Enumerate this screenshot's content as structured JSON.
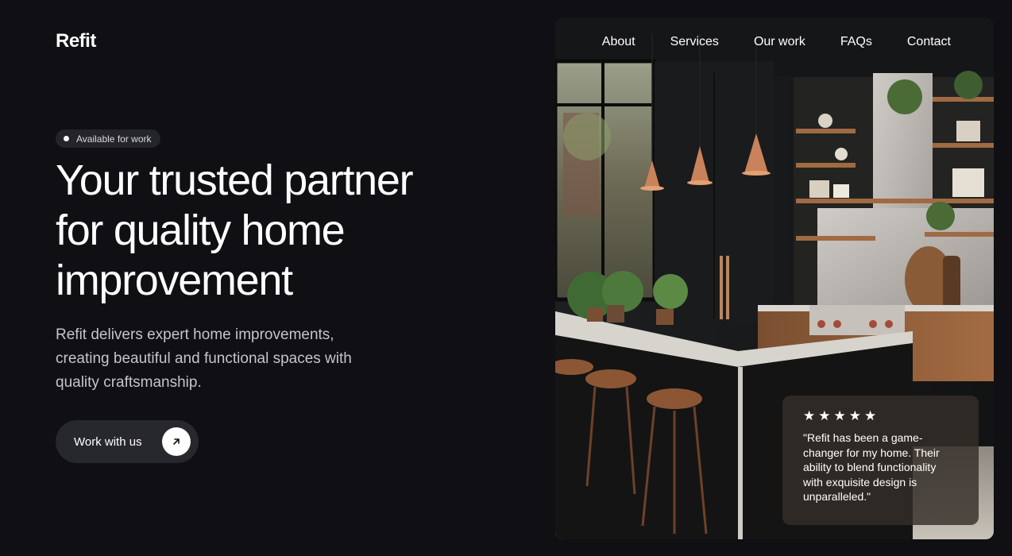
{
  "brand": {
    "name": "Refit"
  },
  "nav": {
    "items": [
      {
        "label": "About"
      },
      {
        "label": "Services"
      },
      {
        "label": "Our work"
      },
      {
        "label": "FAQs"
      },
      {
        "label": "Contact"
      }
    ]
  },
  "hero": {
    "badge": "Available for work",
    "title_line1": "Your trusted partner",
    "title_line2": "for quality home",
    "title_line3": "improvement",
    "description": "Refit delivers expert home improvements, creating beautiful and functional spaces with quality craftsmanship.",
    "cta_label": "Work with us",
    "cta_icon": "arrow-up-right-icon"
  },
  "review": {
    "stars": "★★★★★",
    "rating": 5,
    "text": "\"Refit has been a game-changer for my home. Their ability to blend functionality with exquisite design is unparalleled.\""
  },
  "colors": {
    "background": "#0f0f14",
    "button": "#27272e",
    "badge": "#24242b",
    "accent_copper": "#c9825a",
    "text_muted": "#c4c4cc"
  }
}
